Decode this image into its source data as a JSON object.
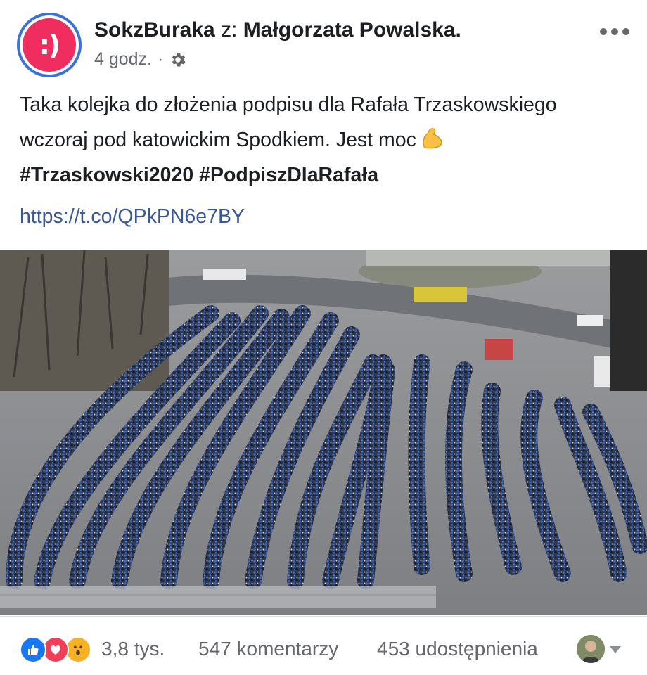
{
  "post": {
    "page_name": "SokzBuraka",
    "with_text": "z:",
    "author": "Małgorzata Powalska.",
    "time": "4 godz.",
    "separator": "·",
    "more_icon": "more-horizontal-icon",
    "audience_icon": "gear-icon",
    "avatar_text": ":)",
    "text_line1": "Taka kolejka do złożenia podpisu dla Rafała Trzaskowskiego",
    "text_line2": "wczoraj pod katowickim Spodkiem. Jest moc",
    "hashtags": "#Trzaskowski2020 #PodpiszDlaRafała",
    "link": "https://t.co/QPkPN6e7BY",
    "emoji": "flexed-biceps"
  },
  "reactions": {
    "icons": [
      "like-icon",
      "love-icon",
      "wow-icon"
    ],
    "count": "3,8 tys.",
    "comments": "547 komentarzy",
    "shares": "453 udostępnienia"
  },
  "colors": {
    "avatar_bg": "#ef2d5e",
    "avatar_ring": "#3b71d8",
    "link": "#385898",
    "like": "#1877f2",
    "love": "#f33e58",
    "wow": "#f7b125"
  }
}
